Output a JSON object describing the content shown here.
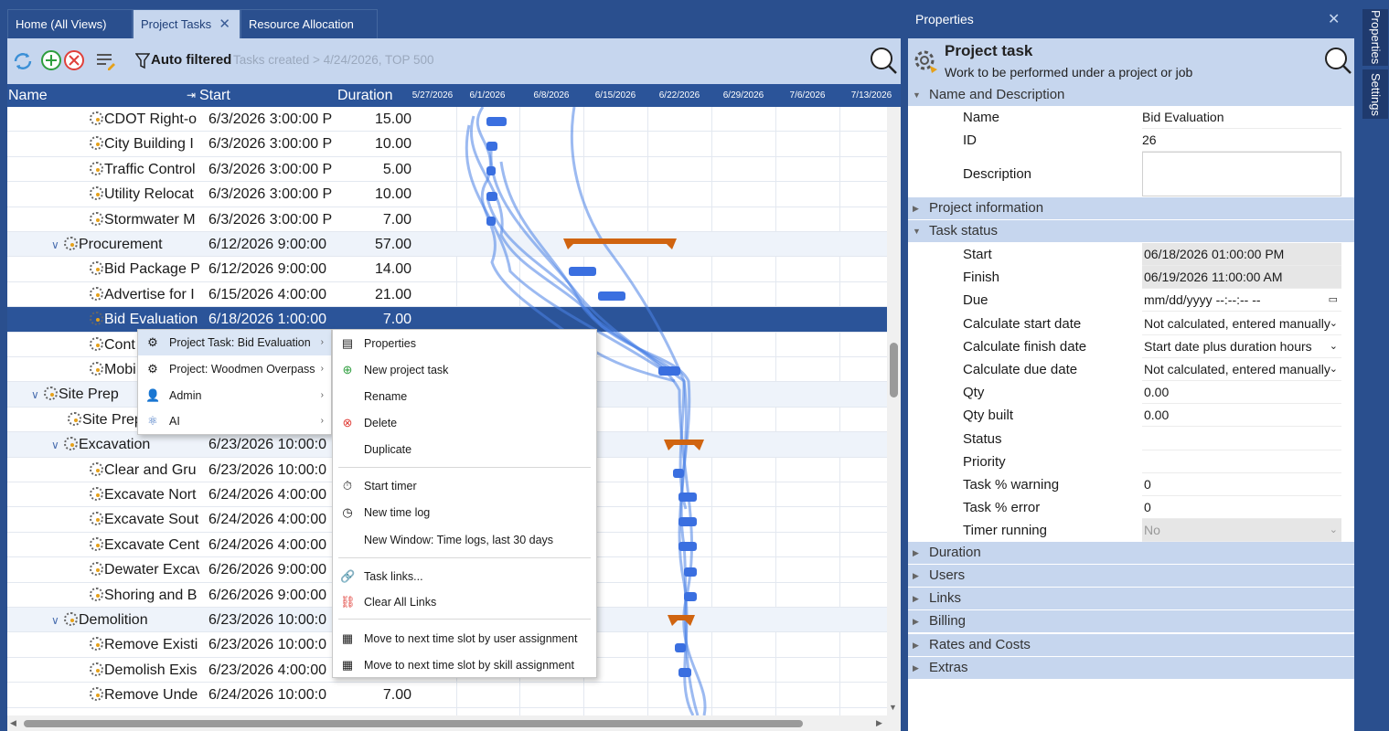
{
  "tabs": [
    {
      "label": "Home (All Views)"
    },
    {
      "label": "Project Tasks",
      "close": "✕"
    },
    {
      "label": "Resource Allocation"
    }
  ],
  "toolbar": {
    "filter_label": "Auto filtered",
    "filter_text": "Tasks created > 4/24/2026, TOP 500"
  },
  "grid": {
    "headers": {
      "name": "Name",
      "start": "Start",
      "duration": "Duration"
    },
    "dates": [
      "5/27/2026",
      "6/1/2026",
      "6/8/2026",
      "6/15/2026",
      "6/22/2026",
      "6/29/2026",
      "7/6/2026",
      "7/13/2026"
    ],
    "rows": [
      {
        "name": "CDOT Right-o",
        "start": "6/3/2026 3:00:00 P",
        "duration": "15.00",
        "level": 2
      },
      {
        "name": "City Building I",
        "start": "6/3/2026 3:00:00 P",
        "duration": "10.00",
        "level": 2
      },
      {
        "name": "Traffic Control",
        "start": "6/3/2026 3:00:00 P",
        "duration": "5.00",
        "level": 2
      },
      {
        "name": "Utility Relocat",
        "start": "6/3/2026 3:00:00 P",
        "duration": "10.00",
        "level": 2
      },
      {
        "name": "Stormwater M",
        "start": "6/3/2026 3:00:00 P",
        "duration": "7.00",
        "level": 2
      },
      {
        "name": "Procurement",
        "start": "6/12/2026 9:00:00",
        "duration": "57.00",
        "level": 1,
        "group": true
      },
      {
        "name": "Bid Package P",
        "start": "6/12/2026 9:00:00",
        "duration": "14.00",
        "level": 2
      },
      {
        "name": "Advertise for I",
        "start": "6/15/2026 4:00:00",
        "duration": "21.00",
        "level": 2
      },
      {
        "name": "Bid Evaluation",
        "start": "6/18/2026 1:00:00",
        "duration": "7.00",
        "level": 2,
        "selected": true
      },
      {
        "name": "Cont",
        "start": "",
        "duration": "",
        "level": 2
      },
      {
        "name": "Mobi",
        "start": "",
        "duration": "",
        "level": 2
      },
      {
        "name": "Site Prep",
        "start": "",
        "duration": "",
        "level": 0,
        "group": true
      },
      {
        "name": "Site Prep",
        "start": "",
        "duration": "",
        "level": 1
      },
      {
        "name": "Excavation",
        "start": "6/23/2026 10:00:0",
        "duration": "",
        "level": 1,
        "group": true
      },
      {
        "name": "Clear and Gru",
        "start": "6/23/2026 10:00:0",
        "duration": "",
        "level": 2
      },
      {
        "name": "Excavate Nort",
        "start": "6/24/2026 4:00:00",
        "duration": "",
        "level": 2
      },
      {
        "name": "Excavate Sout",
        "start": "6/24/2026 4:00:00",
        "duration": "",
        "level": 2
      },
      {
        "name": "Excavate Cent",
        "start": "6/24/2026 4:00:00",
        "duration": "",
        "level": 2
      },
      {
        "name": "Dewater Excav",
        "start": "6/26/2026 9:00:00",
        "duration": "",
        "level": 2
      },
      {
        "name": "Shoring and B",
        "start": "6/26/2026 9:00:00",
        "duration": "",
        "level": 2
      },
      {
        "name": "Demolition",
        "start": "6/23/2026 10:00:0",
        "duration": "",
        "level": 1,
        "group": true
      },
      {
        "name": "Remove Existi",
        "start": "6/23/2026 10:00:0",
        "duration": "",
        "level": 2
      },
      {
        "name": "Demolish Exis",
        "start": "6/23/2026 4:00:00",
        "duration": "",
        "level": 2
      },
      {
        "name": "Remove Unde",
        "start": "6/24/2026 10:00:0",
        "duration": "7.00",
        "level": 2
      }
    ]
  },
  "context_menu": {
    "items": [
      {
        "label": "Project Task: Bid Evaluation"
      },
      {
        "label": "Project: Woodmen Overpass"
      },
      {
        "label": "Admin"
      },
      {
        "label": "AI"
      }
    ],
    "submenu": [
      {
        "label": "Properties"
      },
      {
        "label": "New project task"
      },
      {
        "label": "Rename"
      },
      {
        "label": "Delete"
      },
      {
        "label": "Duplicate"
      },
      {
        "label": "Start timer"
      },
      {
        "label": "New time log"
      },
      {
        "label": "New Window: Time logs, last 30 days"
      },
      {
        "label": "Task links..."
      },
      {
        "label": "Clear All Links"
      },
      {
        "label": "Move to next time slot by user assignment"
      },
      {
        "label": "Move to next time slot by skill assignment"
      }
    ]
  },
  "properties": {
    "title": "Properties",
    "heading": "Project task",
    "subheading": "Work to be performed under a project or job",
    "sections": {
      "name_desc": "Name and Description",
      "project_info": "Project information",
      "task_status": "Task status",
      "duration": "Duration",
      "users": "Users",
      "links": "Links",
      "billing": "Billing",
      "rates": "Rates and Costs",
      "extras": "Extras"
    },
    "fields": {
      "name": {
        "label": "Name",
        "value": "Bid Evaluation"
      },
      "id": {
        "label": "ID",
        "value": "26"
      },
      "description": {
        "label": "Description",
        "value": ""
      },
      "start": {
        "label": "Start",
        "value": "06/18/2026 01:00:00 PM"
      },
      "finish": {
        "label": "Finish",
        "value": "06/19/2026 11:00:00 AM"
      },
      "due": {
        "label": "Due",
        "value": "mm/dd/yyyy --:--:-- --"
      },
      "calc_start": {
        "label": "Calculate start date",
        "value": "Not calculated, entered manually"
      },
      "calc_finish": {
        "label": "Calculate finish date",
        "value": "Start date plus duration hours"
      },
      "calc_due": {
        "label": "Calculate due date",
        "value": "Not calculated, entered manually"
      },
      "qty": {
        "label": "Qty",
        "value": "0.00"
      },
      "qty_built": {
        "label": "Qty built",
        "value": "0.00"
      },
      "status": {
        "label": "Status",
        "value": ""
      },
      "priority": {
        "label": "Priority",
        "value": ""
      },
      "task_warning": {
        "label": "Task % warning",
        "value": "0"
      },
      "task_error": {
        "label": "Task % error",
        "value": "0"
      },
      "timer_running": {
        "label": "Timer running",
        "value": "No"
      }
    }
  },
  "side_tabs": {
    "properties": "Properties",
    "settings": "Settings"
  }
}
